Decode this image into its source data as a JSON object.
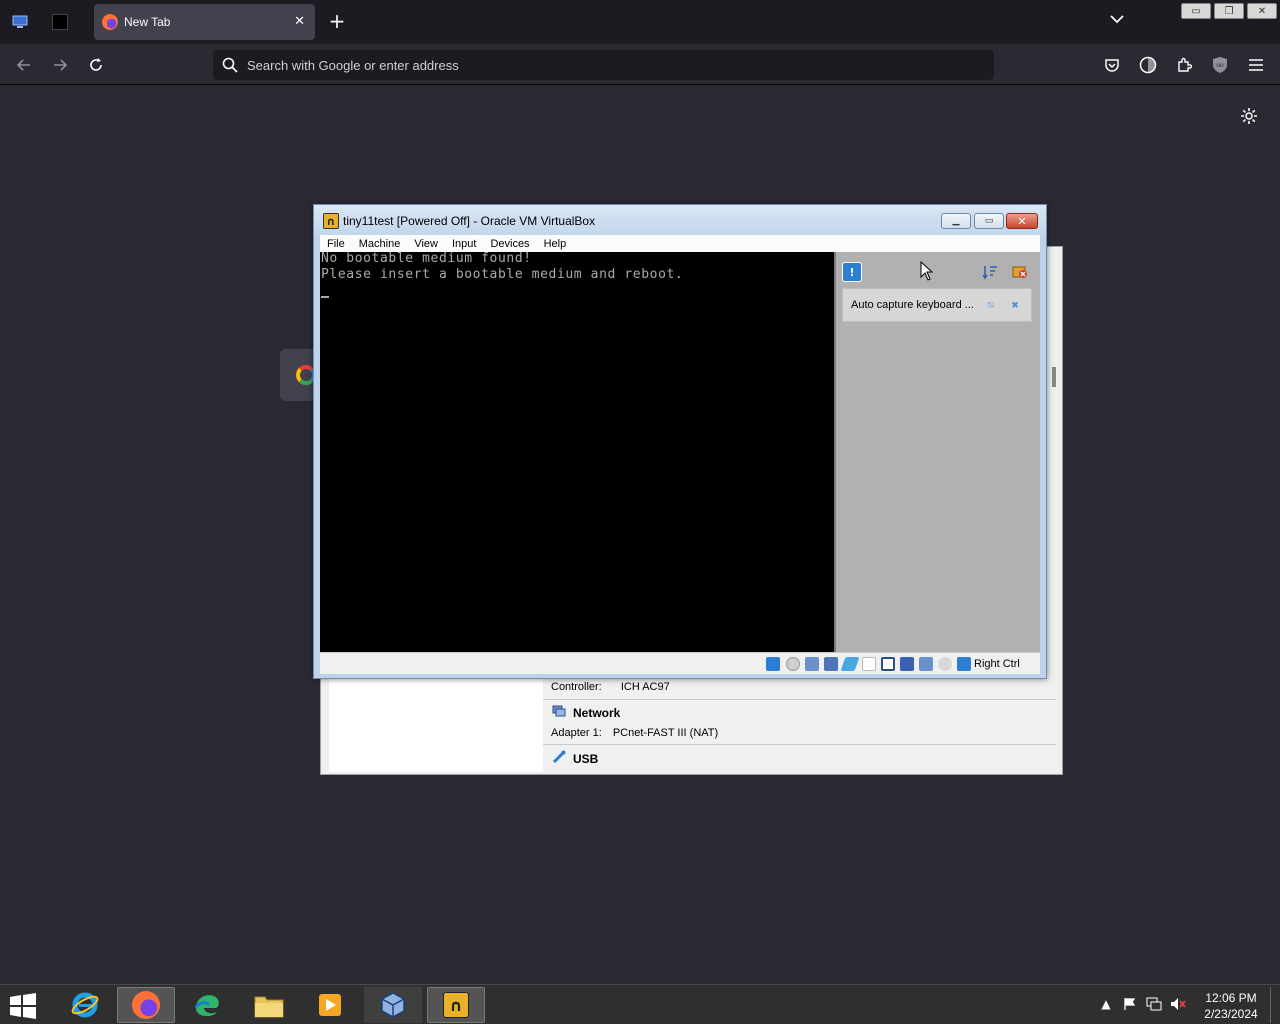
{
  "browser": {
    "tab_title": "New Tab",
    "new_tab_symbol": "+",
    "tab_close_symbol": "✕",
    "url_placeholder": "Search with Google or enter address",
    "icons": [
      "computer-icon",
      "black-square-icon",
      "firefox-icon",
      "back-icon",
      "forward-icon",
      "reload-icon",
      "search-icon",
      "pocket-icon",
      "account-icon",
      "extensions-icon",
      "ublock-icon",
      "menu-icon",
      "gear-icon"
    ]
  },
  "vm_window": {
    "title": "tiny11test [Powered Off] - Oracle VM VirtualBox",
    "menus": [
      "File",
      "Machine",
      "View",
      "Input",
      "Devices",
      "Help"
    ],
    "screen_lines": [
      "No bootable medium found!",
      "Please insert a bootable medium and reboot."
    ],
    "notification": "Auto capture keyboard ...",
    "host_key": "Right Ctrl"
  },
  "manager": {
    "controller_label": "Controller:",
    "controller_value": "ICH AC97",
    "network_header": "Network",
    "adapter_label": "Adapter 1:",
    "adapter_value": "PCnet-FAST III (NAT)",
    "usb_header": "USB"
  },
  "taskbar": {
    "apps": [
      "internet-explorer-icon",
      "firefox-icon",
      "edge-icon",
      "file-explorer-icon",
      "media-player-icon",
      "virtualbox-icon",
      "virtualbox-vm-icon"
    ],
    "time": "12:06 PM",
    "date": "2/23/2024"
  },
  "colors": {
    "browser_bg": "#2b2a33",
    "tabstrip_bg": "#1c1b22",
    "terminal_text": "#aaaaaa",
    "vm_frame": "#bcd3ea"
  }
}
